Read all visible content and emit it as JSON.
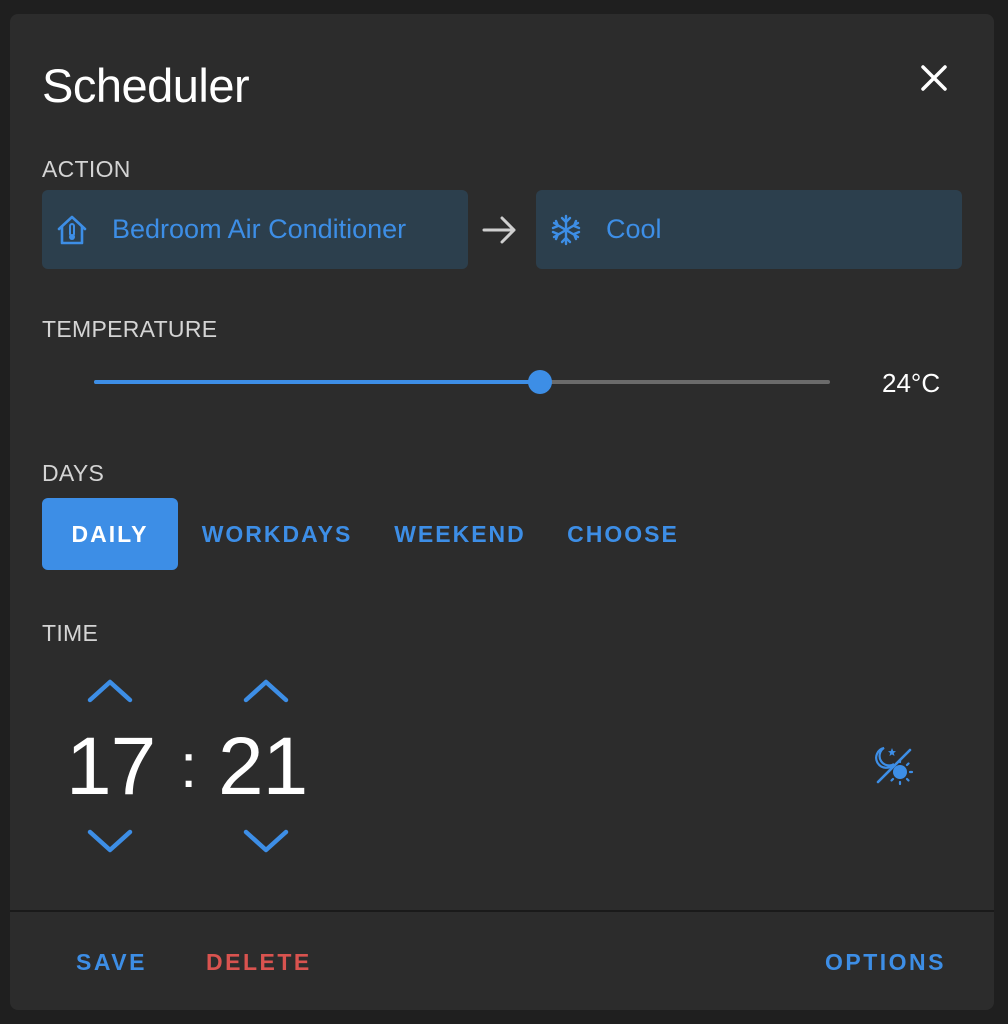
{
  "dialog": {
    "title": "Scheduler"
  },
  "action": {
    "label": "ACTION",
    "entity": "Bedroom Air Conditioner",
    "entity_icon": "home-thermometer-icon",
    "service": "Cool",
    "service_icon": "snowflake-icon"
  },
  "temperature": {
    "label": "TEMPERATURE",
    "value": "24°C",
    "slider_fraction": 0.606
  },
  "days": {
    "label": "DAYS",
    "options": [
      "DAILY",
      "WORKDAYS",
      "WEEKEND",
      "CHOOSE"
    ],
    "selected": "DAILY"
  },
  "time": {
    "label": "TIME",
    "hours": "17",
    "separator": ":",
    "minutes": "21",
    "mode_icon": "sun-moon-icon"
  },
  "footer": {
    "save": "SAVE",
    "delete": "DELETE",
    "options": "OPTIONS"
  },
  "colors": {
    "accent": "#3d8ee6",
    "danger": "#d9534f",
    "background": "#2c2c2c",
    "chip": "#2c3f4d"
  }
}
